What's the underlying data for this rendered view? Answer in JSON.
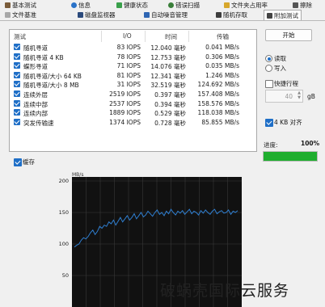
{
  "tabs_row1": [
    {
      "label": "基本测试",
      "icon": "clipboard-icon",
      "color": "#7a5c3a"
    },
    {
      "label": "信息",
      "icon": "info-icon",
      "color": "#2a72c8"
    },
    {
      "label": "健康状态",
      "icon": "heart-icon",
      "color": "#3aa04b"
    },
    {
      "label": "错误扫描",
      "icon": "magnifier-icon",
      "color": "#3a7f3a"
    },
    {
      "label": "文件夹占用率",
      "icon": "folder-icon",
      "color": "#d7a72c"
    },
    {
      "label": "擦除",
      "icon": "trash-icon",
      "color": "#555555"
    }
  ],
  "tabs_row2": [
    {
      "label": "文件基准",
      "icon": "files-icon",
      "color": "#a8a8a8"
    },
    {
      "label": "磁盘监视器",
      "icon": "monitor-icon",
      "color": "#2b4a7c"
    },
    {
      "label": "自动噪音管理",
      "icon": "speaker-icon",
      "color": "#2f66b3"
    },
    {
      "label": "随机存取",
      "icon": "random-icon",
      "color": "#3d3d3d"
    },
    {
      "label": "附加测试",
      "icon": "extra-test-icon",
      "color": "#444444"
    }
  ],
  "table": {
    "headers": [
      "测试",
      "I/O",
      "时间",
      "传输"
    ],
    "rows": [
      {
        "name": "随机寻道",
        "io": "83 IOPS",
        "time": "12.040 毫秒",
        "transfer": "0.041 MB/s"
      },
      {
        "name": "随机寻道 4 KB",
        "io": "78 IOPS",
        "time": "12.753 毫秒",
        "transfer": "0.306 MB/s"
      },
      {
        "name": "蝶形寻道",
        "io": "71 IOPS",
        "time": "14.076 毫秒",
        "transfer": "0.035 MB/s"
      },
      {
        "name": "随机寻道/大小 64 KB",
        "io": "81 IOPS",
        "time": "12.341 毫秒",
        "transfer": "1.246 MB/s"
      },
      {
        "name": "随机寻道/大小 8 MB",
        "io": "31 IOPS",
        "time": "32.519 毫秒",
        "transfer": "124.692 MB/s"
      },
      {
        "name": "连续外层",
        "io": "2519 IOPS",
        "time": "0.397 毫秒",
        "transfer": "157.408 MB/s"
      },
      {
        "name": "连续中部",
        "io": "2537 IOPS",
        "time": "0.394 毫秒",
        "transfer": "158.576 MB/s"
      },
      {
        "name": "连续内部",
        "io": "1889 IOPS",
        "time": "0.529 毫秒",
        "transfer": "118.038 MB/s"
      },
      {
        "name": "突发传输速",
        "io": "1374 IOPS",
        "time": "0.728 毫秒",
        "transfer": "85.855 MB/s"
      }
    ]
  },
  "controls": {
    "start_label": "开始",
    "read_label": "读取",
    "write_label": "写入",
    "quick_label": "快捷行程",
    "quick_value": "40",
    "quick_unit": "gB",
    "align_label": "4 KB 对齐",
    "progress_label": "进度:",
    "progress_text": "100%",
    "progress_fraction": 1.0,
    "progress_color": "#1fae2e",
    "cache_label": "缓存"
  },
  "chart_data": {
    "type": "line",
    "ylabel": "MB/s",
    "yticks": [
      200,
      150,
      100,
      50
    ],
    "ylim": [
      0,
      200
    ],
    "line_color": "#2f7fd1",
    "values": [
      95,
      98,
      100,
      106,
      110,
      108,
      112,
      118,
      122,
      115,
      120,
      128,
      125,
      130,
      128,
      135,
      132,
      138,
      130,
      136,
      142,
      135,
      140,
      145,
      138,
      142,
      148,
      140,
      145,
      150,
      143,
      146,
      152,
      148,
      144,
      150,
      154,
      147,
      150,
      145,
      152,
      148,
      155,
      150,
      146,
      152,
      149,
      153,
      147,
      151,
      155,
      148,
      152,
      150,
      146,
      153,
      149,
      154,
      150,
      147,
      152,
      155,
      148,
      151,
      153,
      149,
      150,
      154,
      147,
      152,
      150,
      153
    ]
  },
  "watermark": "破蜗壳国际云服务"
}
